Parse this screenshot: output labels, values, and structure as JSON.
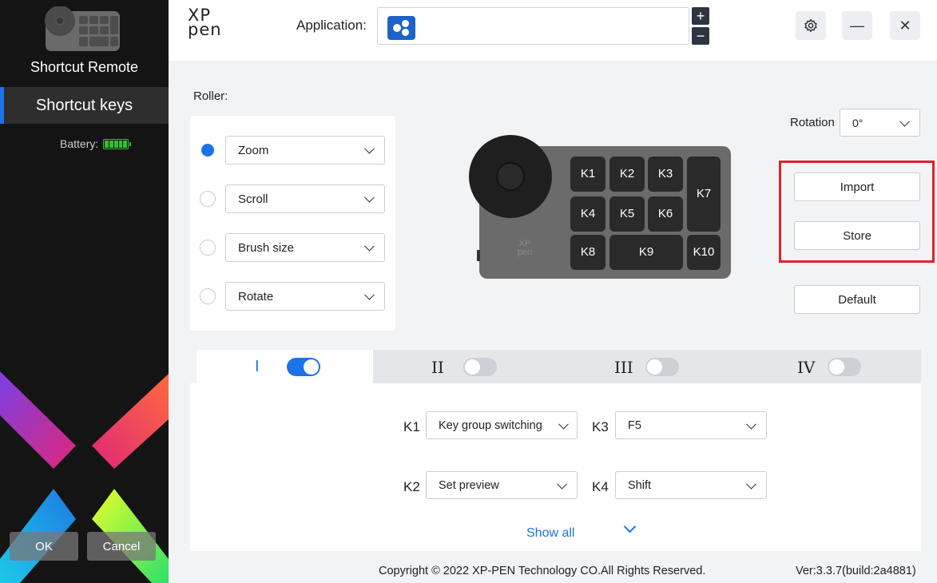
{
  "sidebar": {
    "device_name": "Shortcut Remote",
    "nav_item": "Shortcut keys",
    "battery_label": "Battery:",
    "ok_label": "OK",
    "cancel_label": "Cancel"
  },
  "header": {
    "logo_top": "XP",
    "logo_bottom": "pen",
    "application_label": "Application:",
    "app_icon": "blue-app-icon",
    "add_symbol": "+",
    "remove_symbol": "−",
    "settings_icon": "gear-icon",
    "minimize_symbol": "—",
    "close_symbol": "✕"
  },
  "roller": {
    "label": "Roller:",
    "options": [
      {
        "value": "Zoom",
        "selected": true
      },
      {
        "value": "Scroll",
        "selected": false
      },
      {
        "value": "Brush size",
        "selected": false
      },
      {
        "value": "Rotate",
        "selected": false
      }
    ]
  },
  "device": {
    "brand_top": "XP",
    "brand_bottom": "pen",
    "keys": {
      "k1": "K1",
      "k2": "K2",
      "k3": "K3",
      "k4": "K4",
      "k5": "K5",
      "k6": "K6",
      "k7": "K7",
      "k8": "K8",
      "k9": "K9",
      "k10": "K10"
    }
  },
  "rotation": {
    "label": "Rotation",
    "value": "0°"
  },
  "buttons": {
    "import": "Import",
    "store": "Store",
    "default": "Default"
  },
  "key_groups": {
    "tabs": [
      {
        "label": "I",
        "enabled": true,
        "active": true
      },
      {
        "label": "II",
        "enabled": false,
        "active": false
      },
      {
        "label": "III",
        "enabled": false,
        "active": false
      },
      {
        "label": "IV",
        "enabled": false,
        "active": false
      }
    ],
    "mappings": [
      {
        "key": "K1",
        "value": "Key group switching"
      },
      {
        "key": "K3",
        "value": "F5"
      },
      {
        "key": "K2",
        "value": "Set preview"
      },
      {
        "key": "K4",
        "value": "Shift"
      }
    ],
    "show_all": "Show all"
  },
  "footer": {
    "copyright": "Copyright © 2022  XP-PEN Technology CO.All Rights Reserved.",
    "version": "Ver:3.3.7(build:2a4881)"
  },
  "colors": {
    "accent": "#1a73e8",
    "highlight": "#e02228",
    "sidebar_bg": "#141414",
    "battery": "#31c031"
  }
}
